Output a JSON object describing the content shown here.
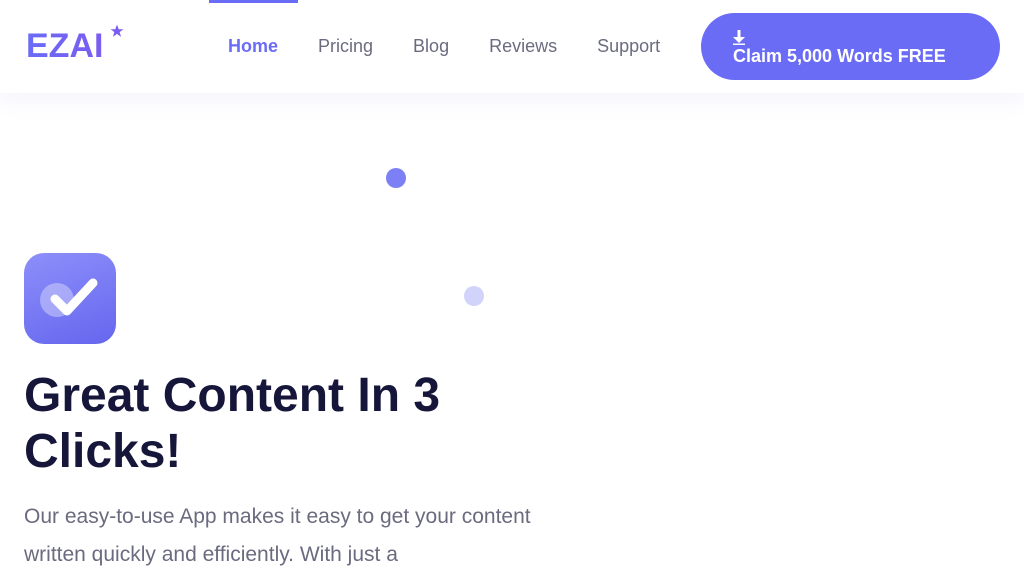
{
  "brand": {
    "logo_text": "EZAI",
    "accent_color": "#6b6cf6"
  },
  "nav": {
    "items": [
      {
        "label": "Home",
        "active": true
      },
      {
        "label": "Pricing",
        "active": false
      },
      {
        "label": "Blog",
        "active": false
      },
      {
        "label": "Reviews",
        "active": false
      },
      {
        "label": "Support",
        "active": false
      }
    ]
  },
  "cta": {
    "label": "Claim 5,000 Words FREE",
    "icon": "download-arrow-icon"
  },
  "hero": {
    "icon": "checkmark-icon",
    "title": "Great Content In 3 Clicks!",
    "description": "Our easy-to-use App makes it easy to get your content written quickly and efficiently. With just a"
  }
}
